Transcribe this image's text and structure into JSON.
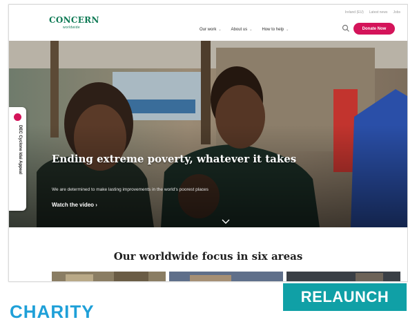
{
  "logo": {
    "main": "CONCERN",
    "sub": "worldwide"
  },
  "utility_nav": [
    "Ireland (EU)",
    "Latest news",
    "Jobs"
  ],
  "main_nav": [
    {
      "label": "Our work"
    },
    {
      "label": "About us"
    },
    {
      "label": "How to help"
    }
  ],
  "donate_label": "Donate Now",
  "appeal_tab": {
    "label": "DEC Cyclone Idai Appeal"
  },
  "hero": {
    "headline": "Ending extreme poverty, whatever it takes",
    "subtitle": "We are determined to make lasting improvements in the world's poorest places",
    "watch_video": "Watch the video ›"
  },
  "section_title": "Our worldwide focus in six areas",
  "badge": "RELAUNCH",
  "page_section": "CHARITY",
  "colors": {
    "brand_green": "#0f7a55",
    "accent_pink": "#d4145a",
    "badge_teal": "#10a0a6",
    "section_blue": "#1fa0d8"
  },
  "icons": [
    "search-icon",
    "chevron-down-icon"
  ]
}
